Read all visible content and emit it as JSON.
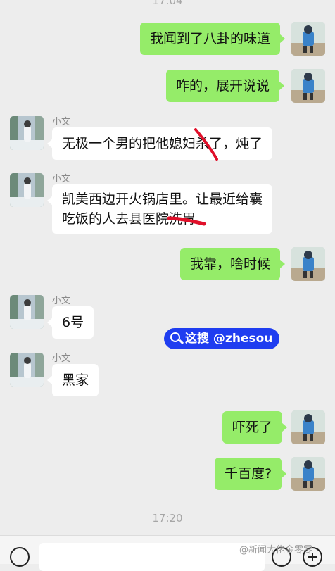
{
  "chat": {
    "time_top": "17:04",
    "time_bottom": "17:20",
    "messages": [
      {
        "from": "me",
        "text": "我闻到了八卦的味道"
      },
      {
        "from": "me",
        "text": "咋的，展开说说"
      },
      {
        "from": "them",
        "sender": "小文",
        "text": "无极一个男的把他媳妇杀了，炖了"
      },
      {
        "from": "them",
        "sender": "小文",
        "line1": "凯美西边开火锅店里。让最近给囊",
        "line2": "吃饭的人去县医院洗胃"
      },
      {
        "from": "me",
        "text": "我靠，啥时候"
      },
      {
        "from": "them",
        "sender": "小文",
        "text": "6号"
      },
      {
        "from": "them",
        "sender": "小文",
        "text": "黑家"
      },
      {
        "from": "me",
        "text": "吓死了"
      },
      {
        "from": "me",
        "text": "千百度?"
      }
    ]
  },
  "watermark": {
    "chip_text": "这搜 @zhesou",
    "corner_text": "@新闻大佬金零零"
  },
  "colors": {
    "my_bubble": "#95ec69",
    "their_bubble": "#ffffff",
    "background": "#ededed",
    "chip": "#1f3df0",
    "strike_mark": "#e0102a"
  },
  "icons": {
    "voice": "voice-icon",
    "emoji": "emoji-icon",
    "plus": "plus-icon",
    "search": "search-icon"
  }
}
